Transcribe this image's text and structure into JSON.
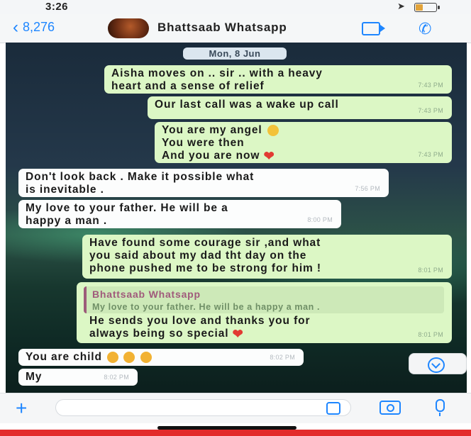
{
  "status_bar": {
    "time": "3:26",
    "battery_level": 0.35
  },
  "header": {
    "back_count": "8,276",
    "contact_name": "Bhattsaab Whatsapp",
    "icons": [
      "chevron-left-icon",
      "video-call-icon",
      "phone-icon"
    ]
  },
  "chat": {
    "date": "Mon, 8 Jun",
    "messages": [
      {
        "lines": [
          "Aisha moves on .. sir .. with a heavy",
          "heart and a sense of relief"
        ],
        "time": "7:43 PM"
      },
      {
        "lines": [
          "Our last call was a wake up call"
        ],
        "time": "7:43 PM"
      },
      {
        "lines": [
          "You are my angel",
          "You were then",
          "And you are now"
        ],
        "time": "7:43 PM"
      },
      {
        "lines": [
          "Don't look back . Make it possible what",
          "is inevitable ."
        ],
        "time": "7:56 PM"
      },
      {
        "lines": [
          "My love to your father. He will be a",
          "happy a man ."
        ],
        "time": "8:00 PM"
      },
      {
        "lines": [
          "Have found some courage sir ,and what",
          "you said about my dad tht day on the",
          "phone pushed me to be strong for him !"
        ],
        "time": "8:01 PM"
      },
      {
        "quote_name": "Bhattsaab Whatsapp",
        "quote_text": "My love to your father. He will be a happy a man .",
        "lines": [
          "He sends you love and thanks you for",
          "always being so special"
        ],
        "time": "8:01 PM"
      },
      {
        "lines": [
          "You are child"
        ],
        "time": "8:02 PM"
      },
      {
        "lines": [
          "My"
        ],
        "time": "8:02 PM"
      }
    ]
  },
  "input_bar": {
    "icons": [
      "plus-icon",
      "sticker-icon",
      "camera-icon",
      "microphone-icon"
    ]
  },
  "colors": {
    "accent": "#1e86ff",
    "outgoing_bubble": "#dcf7c5",
    "incoming_bubble": "#fcfdfd",
    "heart": "#e23b33"
  }
}
